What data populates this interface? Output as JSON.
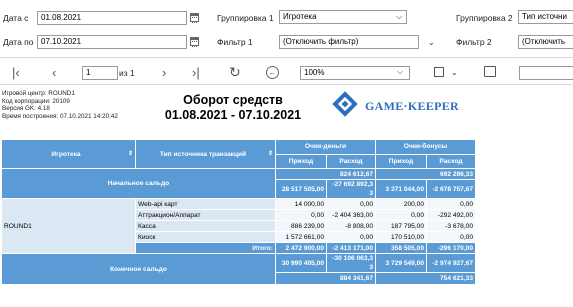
{
  "filters": {
    "date_from_label": "Дата с",
    "date_from_value": "01.08.2021",
    "date_to_label": "Дата по",
    "date_to_value": "07.10.2021",
    "group1_label": "Группировка 1",
    "group1_value": "Игротека",
    "group2_label": "Группировка 2",
    "group2_value": "Тип источни",
    "filter1_label": "Фильтр 1",
    "filter1_value": "(Отключить фильтр)",
    "filter2_label": "Фильтр 2",
    "filter2_value": "(Отключить"
  },
  "toolbar": {
    "page_number": "1",
    "page_of": "из 1",
    "zoom": "100%"
  },
  "report": {
    "meta": [
      "Игровой центр: ROUND1",
      "Код корпорации: 20109",
      "Версия GK: 4.18",
      "Время построения: 07.10.2021 14:20:42"
    ],
    "title": "Оборот средств",
    "period": "01.08.2021 - 07.10.2021",
    "logo_text": "GAME·KEEPER",
    "col_igroteka": "Игротека",
    "col_type": "Тип источника транзакций",
    "grp_money": "Очки-деньги",
    "grp_bonus": "Очки-бонусы",
    "col_in": "Приход",
    "col_out": "Расход",
    "opening_label": "Начальное сальдо",
    "opening_money_total": "824 612,67",
    "opening_bonus_total": "692 286,33",
    "opening_money_in": "28 517 505,00",
    "opening_money_out": "-27 692 892,3 3",
    "opening_bonus_in": "3 371 044,00",
    "opening_bonus_out": "-2 678 757,67",
    "group_name": "ROUND1",
    "rows": [
      {
        "type": "Web-api карт",
        "m_in": "14 000,00",
        "m_out": "0,00",
        "b_in": "200,00",
        "b_out": "0,00"
      },
      {
        "type": "Аттракцион/Аппарат",
        "m_in": "0,00",
        "m_out": "-2 404 363,00",
        "b_in": "0,00",
        "b_out": "-292 492,00"
      },
      {
        "type": "Касса",
        "m_in": "886 239,00",
        "m_out": "-8 808,00",
        "b_in": "187 795,00",
        "b_out": "-3 678,00"
      },
      {
        "type": "Киоск",
        "m_in": "1 572 661,00",
        "m_out": "0,00",
        "b_in": "170 510,00",
        "b_out": "0,00"
      }
    ],
    "itogo_label": "Итого:",
    "itogo_m_in": "2 472 900,00",
    "itogo_m_out": "-2 413 171,00",
    "itogo_b_in": "358 505,00",
    "itogo_b_out": "-296 170,00",
    "closing_label": "Конечное сальдо",
    "closing_money_in": "30 990 405,00",
    "closing_money_out": "-30 106 063,3 3",
    "closing_bonus_in": "3 729 549,00",
    "closing_bonus_out": "-2 974 927,67",
    "closing_money_total": "884 341,67",
    "closing_bonus_total": "754 621,33"
  },
  "colors": {
    "header_blue": "#5b9bd5",
    "light_blue": "#dbe7f3",
    "logo_blue": "#2f6fbf"
  }
}
